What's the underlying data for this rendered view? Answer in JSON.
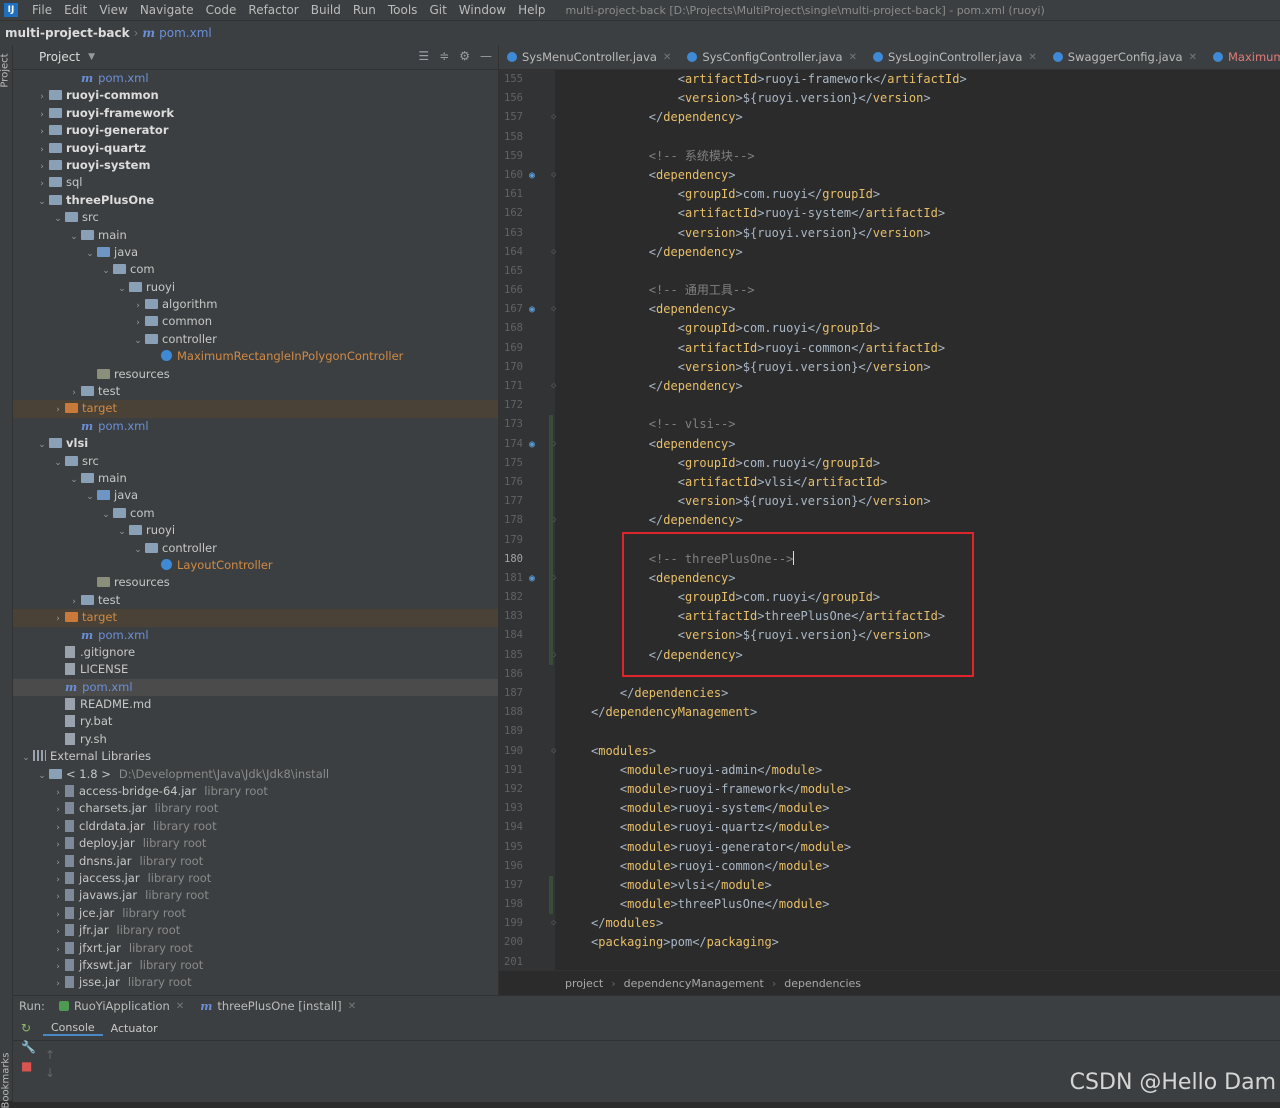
{
  "menubar": {
    "logo": "IJ",
    "items": [
      "File",
      "Edit",
      "View",
      "Navigate",
      "Code",
      "Refactor",
      "Build",
      "Run",
      "Tools",
      "Git",
      "Window",
      "Help"
    ],
    "title": "multi-project-back [D:\\Projects\\MultiProject\\single\\multi-project-back] - pom.xml (ruoyi)"
  },
  "navbar": {
    "project": "multi-project-back",
    "file": "pom.xml",
    "m_icon": "m"
  },
  "left_strip": {
    "top_label": "Project",
    "bottom_label": "Bookmarks"
  },
  "project_panel": {
    "title": "Project",
    "tree": [
      {
        "depth": 3,
        "arrow": "",
        "icon": "m",
        "text": "pom.xml",
        "style": "blue"
      },
      {
        "depth": 1,
        "arrow": "right",
        "icon": "folder",
        "text": "ruoyi-common",
        "style": "bold"
      },
      {
        "depth": 1,
        "arrow": "right",
        "icon": "folder",
        "text": "ruoyi-framework",
        "style": "bold"
      },
      {
        "depth": 1,
        "arrow": "right",
        "icon": "folder",
        "text": "ruoyi-generator",
        "style": "bold"
      },
      {
        "depth": 1,
        "arrow": "right",
        "icon": "folder",
        "text": "ruoyi-quartz",
        "style": "bold"
      },
      {
        "depth": 1,
        "arrow": "right",
        "icon": "folder",
        "text": "ruoyi-system",
        "style": "bold"
      },
      {
        "depth": 1,
        "arrow": "right",
        "icon": "folder",
        "text": "sql",
        "style": ""
      },
      {
        "depth": 1,
        "arrow": "down",
        "icon": "folder",
        "text": "threePlusOne",
        "style": "bold"
      },
      {
        "depth": 2,
        "arrow": "down",
        "icon": "folder",
        "text": "src",
        "style": ""
      },
      {
        "depth": 3,
        "arrow": "down",
        "icon": "folder",
        "text": "main",
        "style": ""
      },
      {
        "depth": 4,
        "arrow": "down",
        "icon": "folder-src",
        "text": "java",
        "style": ""
      },
      {
        "depth": 5,
        "arrow": "down",
        "icon": "folder",
        "text": "com",
        "style": ""
      },
      {
        "depth": 6,
        "arrow": "down",
        "icon": "folder",
        "text": "ruoyi",
        "style": ""
      },
      {
        "depth": 7,
        "arrow": "right",
        "icon": "folder",
        "text": "algorithm",
        "style": ""
      },
      {
        "depth": 7,
        "arrow": "right",
        "icon": "folder",
        "text": "common",
        "style": ""
      },
      {
        "depth": 7,
        "arrow": "down",
        "icon": "folder",
        "text": "controller",
        "style": ""
      },
      {
        "depth": 8,
        "arrow": "",
        "icon": "class",
        "text": "MaximumRectangleInPolygonController",
        "style": "orange"
      },
      {
        "depth": 4,
        "arrow": "",
        "icon": "folder-res",
        "text": "resources",
        "style": ""
      },
      {
        "depth": 3,
        "arrow": "right",
        "icon": "folder",
        "text": "test",
        "style": ""
      },
      {
        "depth": 2,
        "arrow": "right",
        "icon": "folder-orange",
        "text": "target",
        "style": "target"
      },
      {
        "depth": 3,
        "arrow": "",
        "icon": "m",
        "text": "pom.xml",
        "style": "blue"
      },
      {
        "depth": 1,
        "arrow": "down",
        "icon": "folder",
        "text": "vlsi",
        "style": "bold"
      },
      {
        "depth": 2,
        "arrow": "down",
        "icon": "folder",
        "text": "src",
        "style": ""
      },
      {
        "depth": 3,
        "arrow": "down",
        "icon": "folder",
        "text": "main",
        "style": ""
      },
      {
        "depth": 4,
        "arrow": "down",
        "icon": "folder-src",
        "text": "java",
        "style": ""
      },
      {
        "depth": 5,
        "arrow": "down",
        "icon": "folder",
        "text": "com",
        "style": ""
      },
      {
        "depth": 6,
        "arrow": "down",
        "icon": "folder",
        "text": "ruoyi",
        "style": ""
      },
      {
        "depth": 7,
        "arrow": "down",
        "icon": "folder",
        "text": "controller",
        "style": ""
      },
      {
        "depth": 8,
        "arrow": "",
        "icon": "class",
        "text": "LayoutController",
        "style": "orange"
      },
      {
        "depth": 4,
        "arrow": "",
        "icon": "folder-res",
        "text": "resources",
        "style": ""
      },
      {
        "depth": 3,
        "arrow": "right",
        "icon": "folder",
        "text": "test",
        "style": ""
      },
      {
        "depth": 2,
        "arrow": "right",
        "icon": "folder-orange",
        "text": "target",
        "style": "target"
      },
      {
        "depth": 3,
        "arrow": "",
        "icon": "m",
        "text": "pom.xml",
        "style": "blue"
      },
      {
        "depth": 2,
        "arrow": "",
        "icon": "file",
        "text": ".gitignore",
        "style": ""
      },
      {
        "depth": 2,
        "arrow": "",
        "icon": "file",
        "text": "LICENSE",
        "style": ""
      },
      {
        "depth": 2,
        "arrow": "",
        "icon": "m",
        "text": "pom.xml",
        "style": "selected-blue"
      },
      {
        "depth": 2,
        "arrow": "",
        "icon": "file",
        "text": "README.md",
        "style": ""
      },
      {
        "depth": 2,
        "arrow": "",
        "icon": "file",
        "text": "ry.bat",
        "style": ""
      },
      {
        "depth": 2,
        "arrow": "",
        "icon": "file",
        "text": "ry.sh",
        "style": ""
      },
      {
        "depth": 0,
        "arrow": "down",
        "icon": "lib",
        "text": "External Libraries",
        "style": ""
      },
      {
        "depth": 1,
        "arrow": "down",
        "icon": "folder",
        "text": "< 1.8 >",
        "extra": "D:\\Development\\Java\\Jdk\\Jdk8\\install",
        "style": ""
      },
      {
        "depth": 2,
        "arrow": "right",
        "icon": "jar",
        "text": "access-bridge-64.jar",
        "extra": "library root",
        "style": ""
      },
      {
        "depth": 2,
        "arrow": "right",
        "icon": "jar",
        "text": "charsets.jar",
        "extra": "library root",
        "style": ""
      },
      {
        "depth": 2,
        "arrow": "right",
        "icon": "jar",
        "text": "cldrdata.jar",
        "extra": "library root",
        "style": ""
      },
      {
        "depth": 2,
        "arrow": "right",
        "icon": "jar",
        "text": "deploy.jar",
        "extra": "library root",
        "style": ""
      },
      {
        "depth": 2,
        "arrow": "right",
        "icon": "jar",
        "text": "dnsns.jar",
        "extra": "library root",
        "style": ""
      },
      {
        "depth": 2,
        "arrow": "right",
        "icon": "jar",
        "text": "jaccess.jar",
        "extra": "library root",
        "style": ""
      },
      {
        "depth": 2,
        "arrow": "right",
        "icon": "jar",
        "text": "javaws.jar",
        "extra": "library root",
        "style": ""
      },
      {
        "depth": 2,
        "arrow": "right",
        "icon": "jar",
        "text": "jce.jar",
        "extra": "library root",
        "style": ""
      },
      {
        "depth": 2,
        "arrow": "right",
        "icon": "jar",
        "text": "jfr.jar",
        "extra": "library root",
        "style": ""
      },
      {
        "depth": 2,
        "arrow": "right",
        "icon": "jar",
        "text": "jfxrt.jar",
        "extra": "library root",
        "style": ""
      },
      {
        "depth": 2,
        "arrow": "right",
        "icon": "jar",
        "text": "jfxswt.jar",
        "extra": "library root",
        "style": ""
      },
      {
        "depth": 2,
        "arrow": "right",
        "icon": "jar",
        "text": "jsse.jar",
        "extra": "library root",
        "style": ""
      }
    ]
  },
  "editor": {
    "tabs": [
      {
        "label": "SysMenuController.java",
        "active": false
      },
      {
        "label": "SysConfigController.java",
        "active": false
      },
      {
        "label": "SysLoginController.java",
        "active": false
      },
      {
        "label": "SwaggerConfig.java",
        "active": false
      },
      {
        "label": "MaximumRectangleInPo",
        "active": true
      }
    ],
    "lines": [
      {
        "n": "155",
        "code": "            <artifactId>ruoyi-framework</artifactId>"
      },
      {
        "n": "156",
        "code": "            <version>${ruoyi.version}</version>"
      },
      {
        "n": "157",
        "code": "        </dependency>"
      },
      {
        "n": "158",
        "code": ""
      },
      {
        "n": "159",
        "code": "        <!-- 系统模块-->",
        "comment": true
      },
      {
        "n": "160",
        "code": "        <dependency>",
        "mark": true
      },
      {
        "n": "161",
        "code": "            <groupId>com.ruoyi</groupId>"
      },
      {
        "n": "162",
        "code": "            <artifactId>ruoyi-system</artifactId>"
      },
      {
        "n": "163",
        "code": "            <version>${ruoyi.version}</version>"
      },
      {
        "n": "164",
        "code": "        </dependency>"
      },
      {
        "n": "165",
        "code": ""
      },
      {
        "n": "166",
        "code": "        <!-- 通用工具-->",
        "comment": true
      },
      {
        "n": "167",
        "code": "        <dependency>",
        "mark": true
      },
      {
        "n": "168",
        "code": "            <groupId>com.ruoyi</groupId>"
      },
      {
        "n": "169",
        "code": "            <artifactId>ruoyi-common</artifactId>"
      },
      {
        "n": "170",
        "code": "            <version>${ruoyi.version}</version>"
      },
      {
        "n": "171",
        "code": "        </dependency>"
      },
      {
        "n": "172",
        "code": ""
      },
      {
        "n": "173",
        "code": "        <!-- vlsi-->",
        "comment": true
      },
      {
        "n": "174",
        "code": "        <dependency>",
        "mark": true
      },
      {
        "n": "175",
        "code": "            <groupId>com.ruoyi</groupId>"
      },
      {
        "n": "176",
        "code": "            <artifactId>vlsi</artifactId>"
      },
      {
        "n": "177",
        "code": "            <version>${ruoyi.version}</version>"
      },
      {
        "n": "178",
        "code": "        </dependency>"
      },
      {
        "n": "179",
        "code": ""
      },
      {
        "n": "180",
        "code": "        <!-- threePlusOne-->",
        "comment": true,
        "caret": true
      },
      {
        "n": "181",
        "code": "        <dependency>",
        "mark": true
      },
      {
        "n": "182",
        "code": "            <groupId>com.ruoyi</groupId>"
      },
      {
        "n": "183",
        "code": "            <artifactId>threePlusOne</artifactId>"
      },
      {
        "n": "184",
        "code": "            <version>${ruoyi.version}</version>"
      },
      {
        "n": "185",
        "code": "        </dependency>"
      },
      {
        "n": "186",
        "code": ""
      },
      {
        "n": "187",
        "code": "    </dependencies>"
      },
      {
        "n": "188",
        "code": "</dependencyManagement>"
      },
      {
        "n": "189",
        "code": ""
      },
      {
        "n": "190",
        "code": "<modules>"
      },
      {
        "n": "191",
        "code": "    <module>ruoyi-admin</module>"
      },
      {
        "n": "192",
        "code": "    <module>ruoyi-framework</module>"
      },
      {
        "n": "193",
        "code": "    <module>ruoyi-system</module>"
      },
      {
        "n": "194",
        "code": "    <module>ruoyi-quartz</module>"
      },
      {
        "n": "195",
        "code": "    <module>ruoyi-generator</module>"
      },
      {
        "n": "196",
        "code": "    <module>ruoyi-common</module>"
      },
      {
        "n": "197",
        "code": "    <module>vlsi</module>"
      },
      {
        "n": "198",
        "code": "    <module>threePlusOne</module>"
      },
      {
        "n": "199",
        "code": "</modules>"
      },
      {
        "n": "200",
        "code": "<packaging>pom</packaging>"
      },
      {
        "n": "201",
        "code": ""
      }
    ],
    "breadcrumb": [
      "project",
      "dependencyManagement",
      "dependencies"
    ],
    "highlight_color": "#e0242b"
  },
  "run_panel": {
    "label": "Run:",
    "tabs": [
      "RuoYiApplication",
      "threePlusOne [install]"
    ],
    "sub_tabs": [
      "Console",
      "Actuator"
    ]
  },
  "watermark": "CSDN @Hello Dam"
}
